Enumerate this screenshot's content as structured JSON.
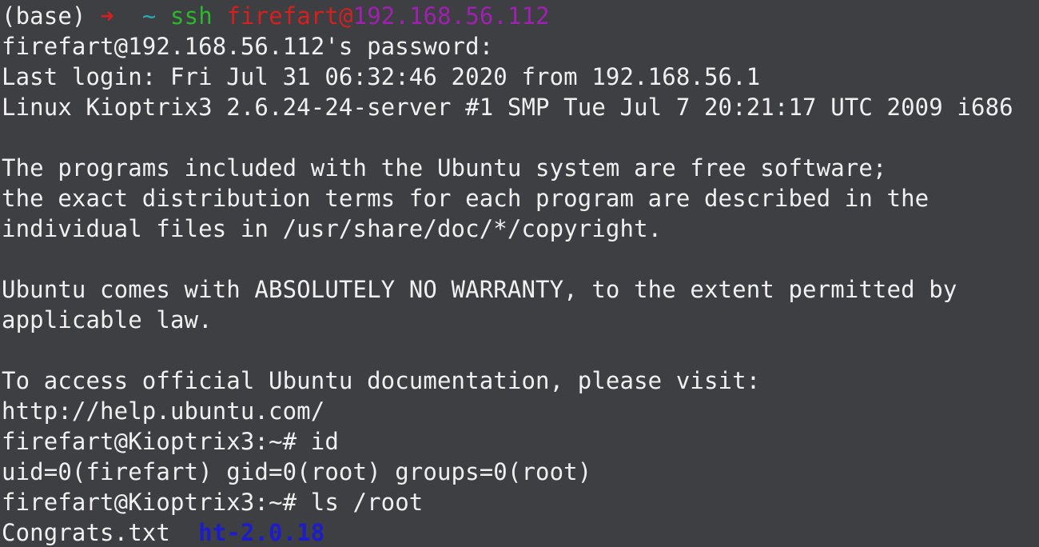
{
  "prompt": {
    "env": "(base)",
    "arrow": "➜",
    "cwd": "~",
    "command": "ssh",
    "user": "firefart",
    "at": "@",
    "host": "192.168.56.112"
  },
  "lines": [
    "firefart@192.168.56.112's password:",
    "Last login: Fri Jul 31 06:32:46 2020 from 192.168.56.1",
    "Linux Kioptrix3 2.6.24-24-server #1 SMP Tue Jul 7 20:21:17 UTC 2009 i686",
    "",
    "The programs included with the Ubuntu system are free software;",
    "the exact distribution terms for each program are described in the",
    "individual files in /usr/share/doc/*/copyright.",
    "",
    "Ubuntu comes with ABSOLUTELY NO WARRANTY, to the extent permitted by",
    "applicable law.",
    "",
    "To access official Ubuntu documentation, please visit:",
    "http://help.ubuntu.com/",
    "firefart@Kioptrix3:~# id",
    "uid=0(firefart) gid=0(root) groups=0(root)",
    "firefart@Kioptrix3:~# ls /root"
  ],
  "ls_output": {
    "file": "Congrats.txt",
    "dir": "ht-2.0.18"
  },
  "colors": {
    "background": "#3d3f42",
    "text": "#f0f0f0",
    "arrow": "#d61f1f",
    "cwd": "#2aa9b4",
    "command": "#2bb82b",
    "user": "#d61f1f",
    "host": "#a020b0",
    "directory": "#1c1ccc"
  }
}
